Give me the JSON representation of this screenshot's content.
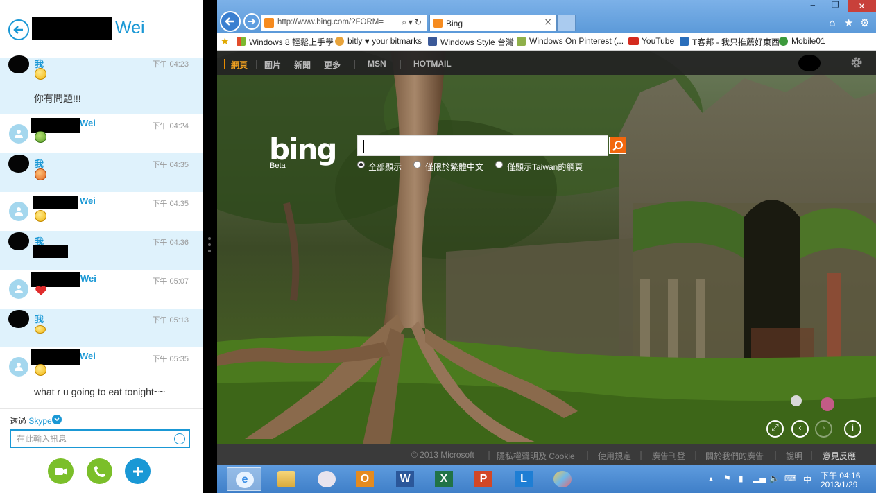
{
  "skype": {
    "conversation_title": "Wei",
    "messages": [
      {
        "sender": "我",
        "time": "下午 04:23",
        "text": "你有問題!!!"
      },
      {
        "sender": "Wei",
        "time": "下午 04:24"
      },
      {
        "sender": "我",
        "time": "下午 04:35"
      },
      {
        "sender": "Wei",
        "time": "下午 04:35"
      },
      {
        "sender": "我",
        "time": "下午 04:36"
      },
      {
        "sender": "Wei",
        "time": "下午 05:07"
      },
      {
        "sender": "我",
        "time": "下午 05:13"
      },
      {
        "sender": "Wei",
        "time": "下午 05:35",
        "text": "what r u going to eat tonight~~"
      }
    ],
    "via_label": "透過",
    "via_service": "Skype",
    "input_placeholder": "在此輸入訊息"
  },
  "browser": {
    "address": "http://www.bing.com/?FORM=",
    "tab_title": "Bing",
    "close_label": "✕",
    "favorites": [
      {
        "label": "Windows 8 輕鬆上手學",
        "icon": "windows-icon",
        "color": "#e24d2b"
      },
      {
        "label": "bitly ♥ your bitmarks",
        "icon": "bitly-icon",
        "color": "#e8a33a"
      },
      {
        "label": "Windows Style 台灣",
        "icon": "facebook-icon",
        "color": "#3b5998"
      },
      {
        "label": "Windows On Pinterest (...",
        "icon": "page-icon",
        "color": "#8fb04a"
      },
      {
        "label": "YouTube",
        "icon": "youtube-icon",
        "color": "#d42a1e"
      },
      {
        "label": "T客邦 - 我只推薦好東西",
        "icon": "tkb-icon",
        "color": "#2a6ebb"
      },
      {
        "label": "Mobile01",
        "icon": "mobile01-icon",
        "color": "#3c9a3c"
      }
    ]
  },
  "bing": {
    "nav": {
      "web": "網頁",
      "images": "圖片",
      "news": "新聞",
      "more": "更多",
      "msn": "MSN",
      "hotmail": "HOTMAIL",
      "sep": "|"
    },
    "logo": "bing",
    "logo_sub": "Beta",
    "scopes": [
      "全部顯示",
      "僅限於繁體中文",
      "僅顯示Taiwan的網頁"
    ],
    "selected_scope": "全部顯示",
    "footer": {
      "copyright": "© 2013 Microsoft",
      "privacy": "隱私權聲明及 Cookie",
      "terms": "使用規定",
      "advertise": "廣告刊登",
      "about_ads": "關於我們的廣告",
      "help": "說明",
      "feedback": "意見反應",
      "sep": "|"
    },
    "image_controls": {
      "expand": "⤢",
      "prev": "‹",
      "next": "›",
      "info": "i"
    }
  },
  "taskbar": {
    "apps": [
      "Internet Explorer",
      "File Explorer",
      "Paint",
      "Outlook",
      "Word",
      "Excel",
      "PowerPoint",
      "Lync",
      "Paint"
    ],
    "tray": {
      "ime": "中"
    },
    "clock_time": "下午 04:16",
    "clock_date": "2013/1/29"
  },
  "colors": {
    "skype_blue": "#1a98d5",
    "skype_green": "#7bbf2a",
    "bing_orange": "#f2670d",
    "taskbar": "#4f8dd3"
  }
}
